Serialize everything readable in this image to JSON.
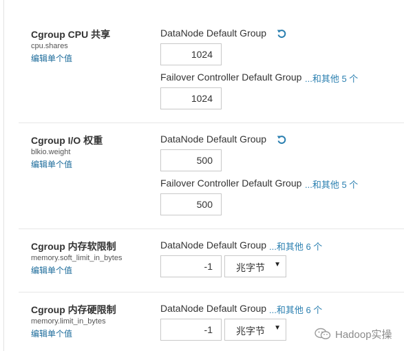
{
  "settings": [
    {
      "title": "Cgroup CPU 共享",
      "key": "cpu.shares",
      "edit_link": "编辑单个值",
      "groups": [
        {
          "label": "DataNode Default Group",
          "value": "1024",
          "has_undo": true
        },
        {
          "label": "Failover Controller Default Group",
          "value": "1024",
          "more": "...和其他 5 个"
        }
      ]
    },
    {
      "title": "Cgroup I/O 权重",
      "key": "blkio.weight",
      "edit_link": "编辑单个值",
      "groups": [
        {
          "label": "DataNode Default Group",
          "value": "500",
          "has_undo": true
        },
        {
          "label": "Failover Controller Default Group",
          "value": "500",
          "more": "...和其他 5 个"
        }
      ]
    },
    {
      "title": "Cgroup 内存软限制",
      "key": "memory.soft_limit_in_bytes",
      "edit_link": "编辑单个值",
      "groups": [
        {
          "label": "DataNode Default Group",
          "value": "-1",
          "unit": "兆字节",
          "more": "...和其他 6 个"
        }
      ]
    },
    {
      "title": "Cgroup 内存硬限制",
      "key": "memory.limit_in_bytes",
      "edit_link": "编辑单个值",
      "groups": [
        {
          "label": "DataNode Default Group",
          "value": "-1",
          "unit": "兆字节",
          "more": "...和其他 6 个"
        }
      ]
    }
  ],
  "watermark": {
    "text": "Hadoop实操",
    "icon": "wechat-icon"
  },
  "colors": {
    "link": "#2a7fb0",
    "edit_link": "#1a6a9a",
    "border": "#c8c8c8"
  }
}
